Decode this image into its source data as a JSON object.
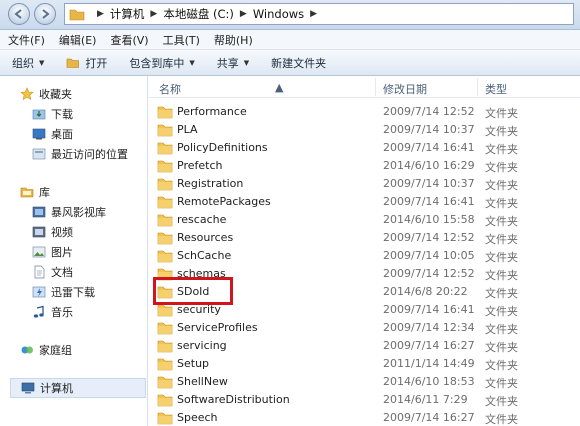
{
  "address": {
    "crumbs": [
      "计算机",
      "本地磁盘 (C:)",
      "Windows"
    ]
  },
  "menu": [
    "文件(F)",
    "编辑(E)",
    "查看(V)",
    "工具(T)",
    "帮助(H)"
  ],
  "toolbar": {
    "organize": "组织",
    "open": "打开",
    "include_in_library": "包含到库中",
    "share": "共享",
    "new_folder": "新建文件夹"
  },
  "sidebar": {
    "favorites": "收藏夹",
    "favorites_items": [
      "下载",
      "桌面",
      "最近访问的位置"
    ],
    "libraries": "库",
    "libraries_items": [
      "暴风影视库",
      "视频",
      "图片",
      "文档",
      "迅雷下载",
      "音乐"
    ],
    "homegroup": "家庭组",
    "computer": "计算机"
  },
  "columns": {
    "name": "名称",
    "modified": "修改日期",
    "type": "类型"
  },
  "files": [
    {
      "name": "Performance",
      "date": "2009/7/14 12:52",
      "type": "文件夹"
    },
    {
      "name": "PLA",
      "date": "2009/7/14 10:37",
      "type": "文件夹"
    },
    {
      "name": "PolicyDefinitions",
      "date": "2009/7/14 16:41",
      "type": "文件夹"
    },
    {
      "name": "Prefetch",
      "date": "2014/6/10 16:29",
      "type": "文件夹"
    },
    {
      "name": "Registration",
      "date": "2009/7/14 10:37",
      "type": "文件夹"
    },
    {
      "name": "RemotePackages",
      "date": "2009/7/14 16:41",
      "type": "文件夹"
    },
    {
      "name": "rescache",
      "date": "2014/6/10 15:58",
      "type": "文件夹"
    },
    {
      "name": "Resources",
      "date": "2009/7/14 12:52",
      "type": "文件夹"
    },
    {
      "name": "SchCache",
      "date": "2009/7/14 10:05",
      "type": "文件夹"
    },
    {
      "name": "schemas",
      "date": "2009/7/14 12:52",
      "type": "文件夹"
    },
    {
      "name": "SDoId",
      "date": "2014/6/8 20:22",
      "type": "文件夹"
    },
    {
      "name": "security",
      "date": "2009/7/14 16:41",
      "type": "文件夹"
    },
    {
      "name": "ServiceProfiles",
      "date": "2009/7/14 12:34",
      "type": "文件夹"
    },
    {
      "name": "servicing",
      "date": "2009/7/14 16:27",
      "type": "文件夹"
    },
    {
      "name": "Setup",
      "date": "2011/1/14 14:49",
      "type": "文件夹"
    },
    {
      "name": "ShellNew",
      "date": "2014/6/10 18:53",
      "type": "文件夹"
    },
    {
      "name": "SoftwareDistribution",
      "date": "2014/6/11 7:29",
      "type": "文件夹"
    },
    {
      "name": "Speech",
      "date": "2009/7/14 16:27",
      "type": "文件夹"
    }
  ],
  "colors": {
    "highlight": "#d2141c",
    "folder": "#f2c34e"
  }
}
